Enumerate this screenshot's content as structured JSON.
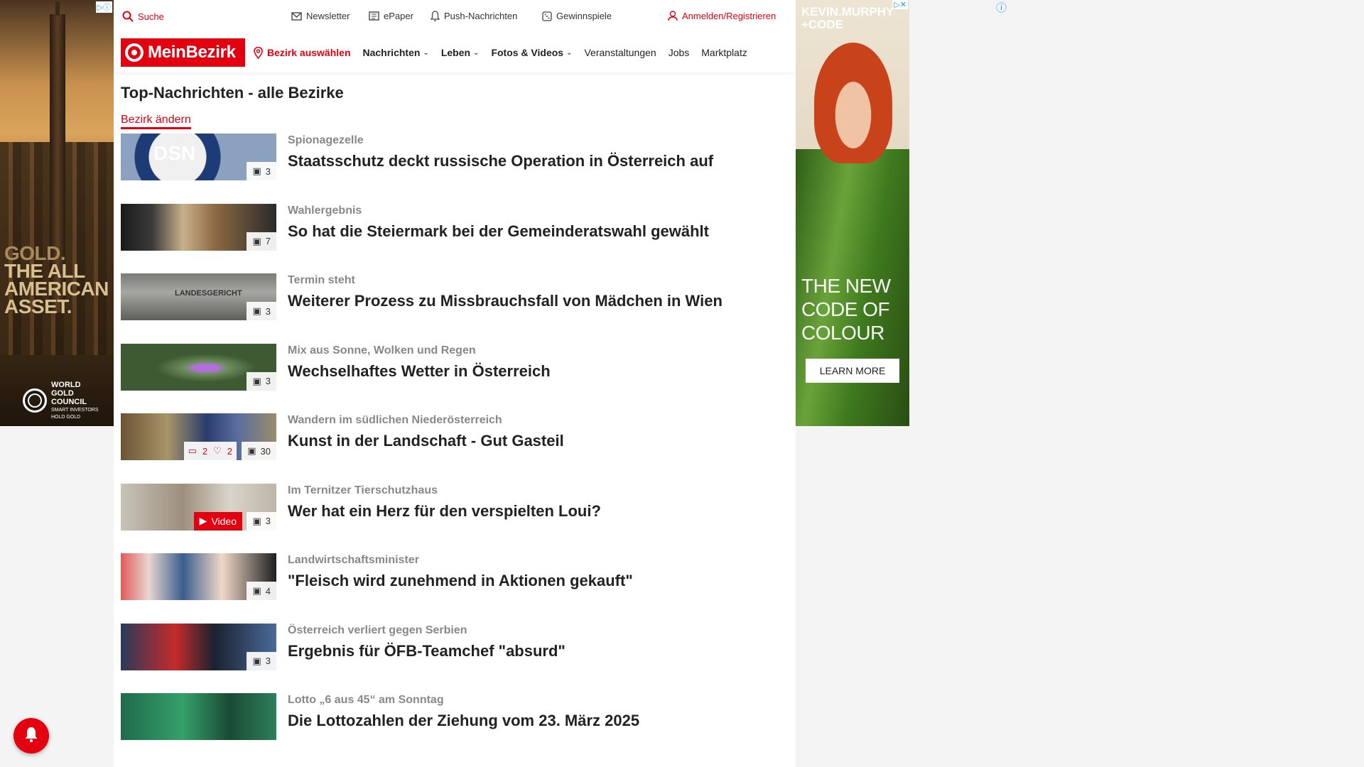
{
  "ads": {
    "left": {
      "headline_lines": [
        "GOLD.",
        "THE ALL",
        "AMERICAN",
        "ASSET."
      ],
      "sponsor": [
        "WORLD",
        "GOLD",
        "COUNCIL"
      ],
      "sponsor_tagline": [
        "SMART INVESTORS",
        "HOLD GOLD"
      ]
    },
    "right": {
      "brand_lines": [
        "KEVIN.MURPHY",
        "+CODE"
      ],
      "claim_lines": [
        "THE NEW",
        "CODE OF",
        "COLOUR"
      ],
      "cta": "LEARN MORE"
    }
  },
  "topbar": {
    "search": "Suche",
    "newsletter": "Newsletter",
    "epaper": "ePaper",
    "push": "Push-Nachrichten",
    "games": "Gewinnspiele",
    "login": "Anmelden/Registrieren"
  },
  "nav": {
    "logo": "MeinBezirk",
    "bezirk": "Bezirk auswählen",
    "links": [
      "Nachrichten",
      "Leben",
      "Fotos & Videos",
      "Veranstaltungen",
      "Jobs",
      "Marktplatz"
    ]
  },
  "page": {
    "title": "Top-Nachrichten - alle Bezirke",
    "change_bezirk": "Bezirk ändern"
  },
  "articles": [
    {
      "kicker": "Spionagezelle",
      "headline": "Staatsschutz deckt russische Operation in Österreich auf",
      "images": "3"
    },
    {
      "kicker": "Wahlergebnis",
      "headline": "So hat die Steiermark bei der Gemeinderatswahl gewählt",
      "images": "7"
    },
    {
      "kicker": "Termin steht",
      "headline": "Weiterer Prozess zu Missbrauchsfall von Mädchen in Wien",
      "images": "3"
    },
    {
      "kicker": "Mix aus Sonne, Wolken und Regen",
      "headline": "Wechselhaftes Wetter in Österreich",
      "images": "3"
    },
    {
      "kicker": "Wandern im südlichen Niederösterreich",
      "headline": "Kunst in der Landschaft - Gut Gasteil",
      "images": "30",
      "comments": "2",
      "likes": "2"
    },
    {
      "kicker": "Im Ternitzer Tierschutzhaus",
      "headline": "Wer hat ein Herz für den verspielten Loui?",
      "images": "3",
      "video": "Video"
    },
    {
      "kicker": "Landwirtschaftsminister",
      "headline": "\"Fleisch wird zunehmend in Aktionen gekauft\"",
      "images": "4"
    },
    {
      "kicker": "Österreich verliert gegen Serbien",
      "headline": "Ergebnis für ÖFB-Teamchef \"absurd\"",
      "images": "3"
    },
    {
      "kicker": "Lotto „6 aus 45“ am Sonntag",
      "headline": "Die Lottozahlen der Ziehung vom 23. März 2025"
    }
  ],
  "thumb_texts": {
    "dsn": "DSN",
    "court": "LANDESGERICHT"
  }
}
